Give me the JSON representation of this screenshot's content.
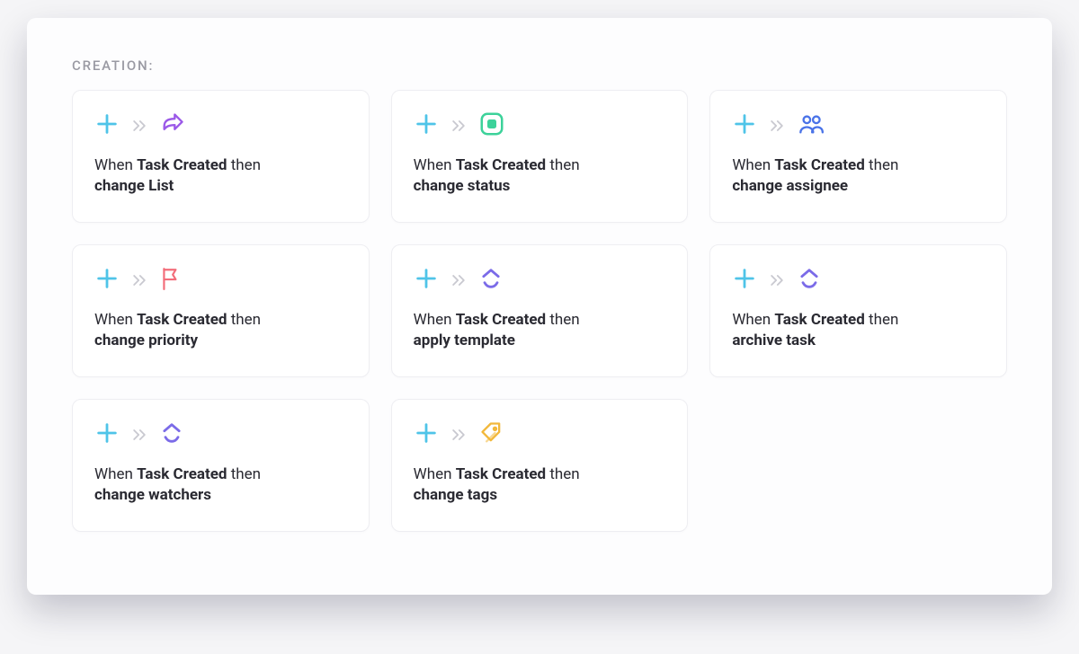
{
  "section": {
    "title": "CREATION:"
  },
  "text": {
    "when": "When ",
    "then": " then "
  },
  "cards": [
    {
      "id": "change-list",
      "icon": "share",
      "trigger": "Task Created",
      "action": "change List"
    },
    {
      "id": "change-status",
      "icon": "status",
      "trigger": "Task Created",
      "action": "change status"
    },
    {
      "id": "change-assignee",
      "icon": "people",
      "trigger": "Task Created",
      "action": "change assignee"
    },
    {
      "id": "change-priority",
      "icon": "flag",
      "trigger": "Task Created",
      "action": "change priority"
    },
    {
      "id": "apply-template",
      "icon": "clickup",
      "trigger": "Task Created",
      "action": "apply template"
    },
    {
      "id": "archive-task",
      "icon": "clickup",
      "trigger": "Task Created",
      "action": "archive task"
    },
    {
      "id": "change-watchers",
      "icon": "clickup",
      "trigger": "Task Created",
      "action": "change watchers"
    },
    {
      "id": "change-tags",
      "icon": "tag",
      "trigger": "Task Created",
      "action": "change tags"
    }
  ],
  "colors": {
    "plus": "#4fc4e8",
    "chev": "#c9c9d0",
    "share": "#9b59e8",
    "status_stroke": "#3cd29a",
    "status_fill": "#3cd29a",
    "people": "#4a73e8",
    "flag": "#f36d7a",
    "clickup": "#7b6be8",
    "tag": "#f2b83b"
  }
}
